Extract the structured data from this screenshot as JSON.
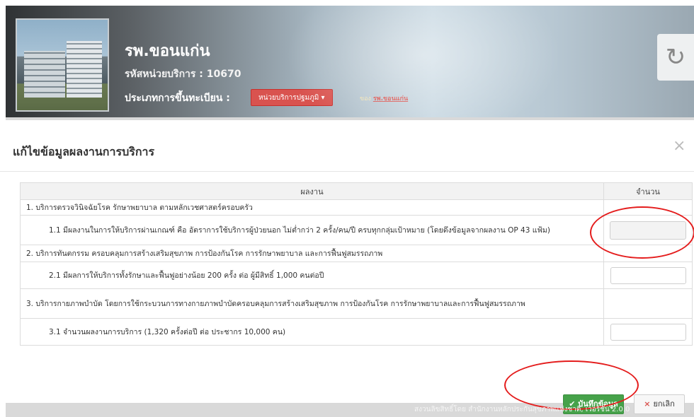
{
  "header": {
    "hospital_name": "รพ.ขอนแก่น",
    "unit_code": "รหัสหน่วยบริการ : 10670",
    "reg_label": "ประเภทการขึ้นทะเบียน :",
    "reg_type": "หน่วยบริการปฐมภูมิ",
    "reg_sub_prefix": "ของ",
    "reg_sub_link": "รพ.ขอนแก่น"
  },
  "modal": {
    "title": "แก้ไขข้อมูลผลงานการบริการ",
    "columns": {
      "work": "ผลงาน",
      "amount": "จำนวน"
    },
    "rows": [
      {
        "text": "1. บริการตรวจวินิจฉัยโรค รักษาพยาบาล ตามหลักเวชศาสตร์ครอบครัว"
      },
      {
        "text": "1.1 มีผลงานในการให้บริการผ่านเกณฑ์ คือ อัตราการใช้บริการผู้ป่วยนอก ไม่ต่ำกว่า 2 ครั้ง/คน/ปี ครบทุกกลุ่มเป้าหมาย (โดยดึงข้อมูลจากผลงาน OP 43 แฟ้ม)",
        "input_value": ""
      },
      {
        "text": "2. บริการทันตกรรม ครอบคลุมการสร้างเสริมสุขภาพ การป้องกันโรค การรักษาพยาบาล และการฟื้นฟูสมรรถภาพ"
      },
      {
        "text": "2.1 มีผลการให้บริการทั้งรักษาและฟื้นฟูอย่างน้อย 200 ครั้ง ต่อ ผู้มีสิทธิ์ 1,000 คนต่อปี",
        "input_value": ""
      },
      {
        "text": "3. บริการกายภาพบำบัด โดยการใช้กระบวนการทางกายภาพบำบัดครอบคลุมการสร้างเสริมสุขภาพ การป้องกันโรค การรักษาพยาบาลและการฟื้นฟูสมรรถภาพ"
      },
      {
        "text": "3.1 จำนวนผลงานการบริการ (1,320 ครั้งต่อปี ต่อ ประชากร 10,000 คน)",
        "input_value": ""
      }
    ],
    "save_label": "บันทึกข้อมูล",
    "cancel_label": "ยกเลิก",
    "close_glyph": "×"
  },
  "footer": "สงวนลิขสิทธิ์โดย สำนักงานหลักประกันสุขภาพแห่งชาติ, เวอร์ชั่น 2.0.0",
  "colors": {
    "danger": "#d9534f",
    "success": "#46a24a",
    "annotation": "#e41c1c"
  },
  "icons": {
    "refresh": "refresh-icon",
    "check": "check-icon",
    "close": "close-icon"
  }
}
